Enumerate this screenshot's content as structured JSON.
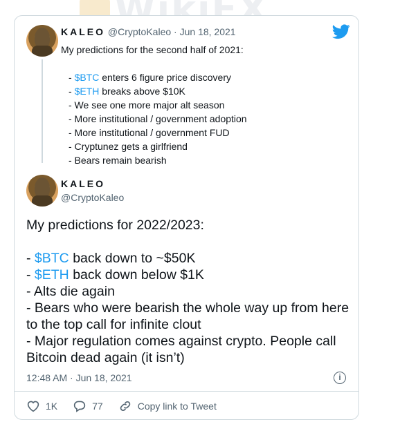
{
  "watermark": "WikiFX",
  "quoted": {
    "name": "KALEO",
    "handle": "@CryptoKaleo",
    "date": "Jun 18, 2021",
    "intro": "My predictions for the second half of 2021:",
    "items": [
      {
        "ticker": "$BTC",
        "rest": " enters 6 figure price discovery"
      },
      {
        "ticker": "$ETH",
        "rest": " breaks above $10K"
      },
      {
        "ticker": "",
        "rest": "- We see one more major alt season"
      },
      {
        "ticker": "",
        "rest": "- More institutional / government adoption"
      },
      {
        "ticker": "",
        "rest": "- More institutional / government FUD"
      },
      {
        "ticker": "",
        "rest": "- Cryptunez gets a girlfriend"
      },
      {
        "ticker": "",
        "rest": "- Bears remain bearish"
      }
    ]
  },
  "main": {
    "name": "KALEO",
    "handle": "@CryptoKaleo",
    "intro": "My predictions for 2022/2023:",
    "line1_ticker": "$BTC",
    "line1_rest": " back down to ~$50K",
    "line2_ticker": "$ETH",
    "line2_rest": " back down below $1K",
    "line3": "- Alts die again",
    "line4": "- Bears who were bearish the whole way up from here to the top call for infinite clout",
    "line5": "- Major regulation comes against crypto. People call Bitcoin dead again (it isn’t)",
    "timestamp": "12:48 AM · Jun 18, 2021"
  },
  "actions": {
    "likes": "1K",
    "replies": "77",
    "copy_link": "Copy link to Tweet"
  },
  "colors": {
    "accent": "#1d9bf0",
    "text": "#0f1419",
    "muted": "#536471"
  }
}
